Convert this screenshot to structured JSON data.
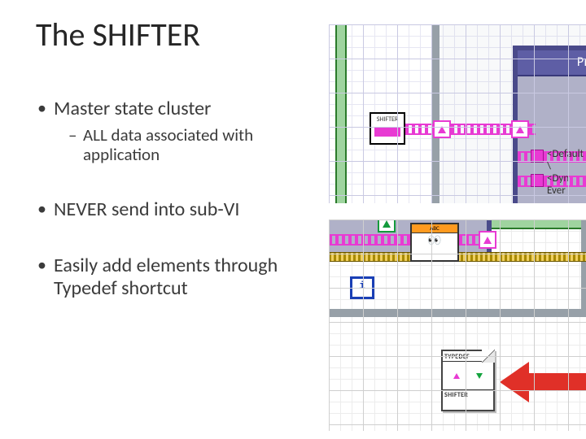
{
  "title": "The SHIFTER",
  "bullets": [
    {
      "text": "Master state cluster",
      "sub": [
        "ALL data associated with application"
      ]
    },
    {
      "text": "NEVER send into sub-VI"
    },
    {
      "text": "Easily add elements through Typedef shortcut"
    }
  ],
  "diagram1": {
    "shifter_label": "SHIFTER",
    "event_header": "Primary",
    "tag_default": "<Default \\",
    "tag_dynevt": "<Dyn Ever"
  },
  "diagram2": {
    "node_header": "ABC",
    "i_terminal": "i",
    "typedef_top": "TYPEDEF",
    "typedef_bottom": "SHIFTER"
  }
}
